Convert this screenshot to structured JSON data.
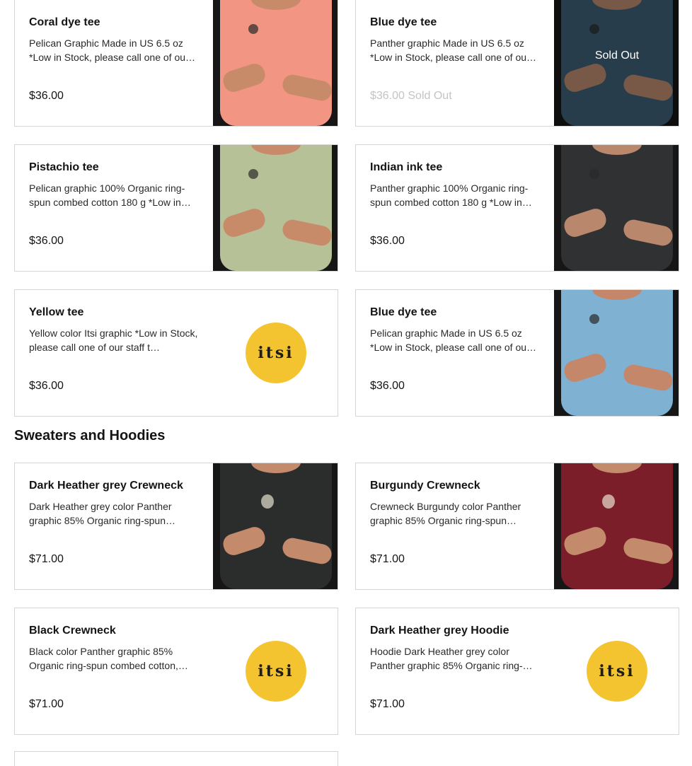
{
  "section_tees": {
    "items": [
      {
        "title": "Coral dye tee",
        "desc": "Pelican Graphic Made in US 6.5 oz *Low in Stock, please call one of ou…",
        "price": "$36.00",
        "media": "photo",
        "shirt_color": "#f29683",
        "skin": "#c88b6a"
      },
      {
        "title": "Blue dye tee",
        "desc": "Panther graphic Made in US 6.5 oz *Low in Stock, please call one of ou…",
        "price": "$36.00 Sold Out",
        "media": "photo",
        "shirt_color": "#3d5f74",
        "skin": "#b9876c",
        "sold_out": true,
        "sold_out_label": "Sold Out"
      },
      {
        "title": "Pistachio tee",
        "desc": "Pelican graphic 100% Organic ring-spun combed cotton 180 g *Low in…",
        "price": "$36.00",
        "media": "photo",
        "shirt_color": "#b7c198",
        "skin": "#c88b6a"
      },
      {
        "title": "Indian ink tee",
        "desc": "Panther graphic 100% Organic ring-spun combed cotton 180 g *Low in…",
        "price": "$36.00",
        "media": "photo",
        "shirt_color": "#2f3133",
        "skin": "#b9876c"
      },
      {
        "title": "Yellow tee",
        "desc": "Yellow color Itsi graphic *Low in Stock, please call one of our staff t…",
        "price": "$36.00",
        "media": "logo",
        "logo_text": "itsi"
      },
      {
        "title": "Blue dye tee",
        "desc": "Pelican graphic Made in US 6.5 oz *Low in Stock, please call one of ou…",
        "price": "$36.00",
        "media": "photo",
        "shirt_color": "#7fb1d3",
        "skin": "#c4876a"
      }
    ]
  },
  "section_sweaters": {
    "title": "Sweaters and Hoodies",
    "items": [
      {
        "title": "Dark Heather grey Crewneck",
        "desc": "Dark Heather grey color Panther graphic 85% Organic ring-spun…",
        "price": "$71.00",
        "media": "photo",
        "shirt_color": "#2a2d2b",
        "skin": "#c48a6c",
        "emblem": true
      },
      {
        "title": "Burgundy Crewneck",
        "desc": "Crewneck Burgundy color Panther graphic 85% Organic ring-spun…",
        "price": "$71.00",
        "media": "photo",
        "shirt_color": "#7c1d2a",
        "skin": "#c48a6c",
        "emblem": true
      },
      {
        "title": "Black Crewneck",
        "desc": "Black color Panther graphic 85% Organic ring-spun combed cotton,…",
        "price": "$71.00",
        "media": "logo",
        "logo_text": "itsi"
      },
      {
        "title": "Dark Heather grey Hoodie",
        "desc": "Hoodie Dark Heather grey color Panther graphic 85% Organic ring-…",
        "price": "$71.00",
        "media": "logo",
        "logo_text": "itsi"
      }
    ]
  },
  "colors": {
    "logo_yellow": "#f4c430",
    "photo_bg": "#161616",
    "border": "#d6d6d6",
    "sold_out_text": "#c4c4c4"
  }
}
